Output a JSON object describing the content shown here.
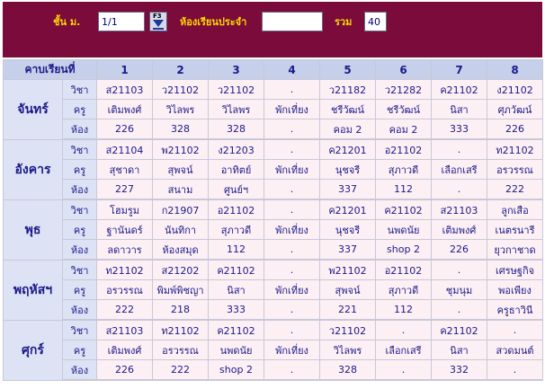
{
  "filter": {
    "class_label": "ชั้น ม.",
    "class_value": "1/1",
    "room_label": "ห้องเรียนประจำ",
    "room_value": "",
    "total_label": "รวม",
    "total_value": "40",
    "lookup_key": "F3"
  },
  "header": {
    "period_label": "คาบเรียนที่",
    "periods": [
      "1",
      "2",
      "3",
      "4",
      "5",
      "6",
      "7",
      "8"
    ]
  },
  "role_labels": [
    "วิชา",
    "ครู",
    "ห้อง"
  ],
  "days": [
    {
      "name": "จันทร์",
      "rows": [
        [
          "ส21103",
          "ว21102",
          "ว21102",
          ".",
          "ว21182",
          "ว21282",
          "ค21102",
          "ง21102"
        ],
        [
          "เติมพงศ์",
          "วิไลพร",
          "วิไลพร",
          "พักเที่ยง",
          "ชรีวัฒน์",
          "ชรีวัฒน์",
          "นิสา",
          "ศุภวัฒน์"
        ],
        [
          "226",
          "328",
          "328",
          ".",
          "คอม 2",
          "คอม 2",
          "333",
          "226"
        ]
      ]
    },
    {
      "name": "อังคาร",
      "rows": [
        [
          "ส21104",
          "พ21102",
          "ง21203",
          ".",
          "ค21201",
          "อ21102",
          ".",
          "ท21102"
        ],
        [
          "สุชาดา",
          "สุพจน์",
          "อาทิตย์",
          "พักเที่ยง",
          "นุชจรี",
          "สุภาวดี",
          "เลือกเสรี",
          "อรวรรณ"
        ],
        [
          "227",
          "สนาม",
          "ศูนย์ฯ",
          ".",
          "337",
          "112",
          ".",
          "222"
        ]
      ]
    },
    {
      "name": "พุธ",
      "rows": [
        [
          "โฮมรูม",
          "ก21907",
          "อ21102",
          ".",
          "ค21201",
          "ค21102",
          "ส21103",
          "ลูกเสือ"
        ],
        [
          "ฐานันดร์",
          "นันทิกา",
          "สุภาวดี",
          "พักเที่ยง",
          "นุชจรี",
          "นพดนัย",
          "เติมพงศ์",
          "เนตรนารี"
        ],
        [
          "ลดาวาร",
          "ห้องสมุด",
          "112",
          ".",
          "337",
          "shop 2",
          "226",
          "ยุวกาชาด"
        ]
      ]
    },
    {
      "name": "พฤหัสฯ",
      "rows": [
        [
          "ท21102",
          "ส21202",
          "ค21102",
          ".",
          "พ21102",
          "อ21102",
          ".",
          "เศรษฐกิจ"
        ],
        [
          "อรวรรณ",
          "พิมพ์พิชญา",
          "นิสา",
          "พักเที่ยง",
          "สุพจน์",
          "สุภาวดี",
          "ชุมนุม",
          "พอเพียง"
        ],
        [
          "222",
          "218",
          "333",
          ".",
          "221",
          "112",
          ".",
          "ครูธาวินี"
        ]
      ]
    },
    {
      "name": "ศุกร์",
      "rows": [
        [
          "ส21103",
          "ท21102",
          "ค21102",
          ".",
          "ว21102",
          ".",
          "ค21102",
          "."
        ],
        [
          "เติมพงศ์",
          "อรวรรณ",
          "นพดนัย",
          "พักเที่ยง",
          "วิไลพร",
          "เลือกเสรี",
          "นิสา",
          "สวดมนต์"
        ],
        [
          "226",
          "222",
          "shop 2",
          ".",
          "328",
          ".",
          "332",
          "."
        ]
      ]
    }
  ]
}
